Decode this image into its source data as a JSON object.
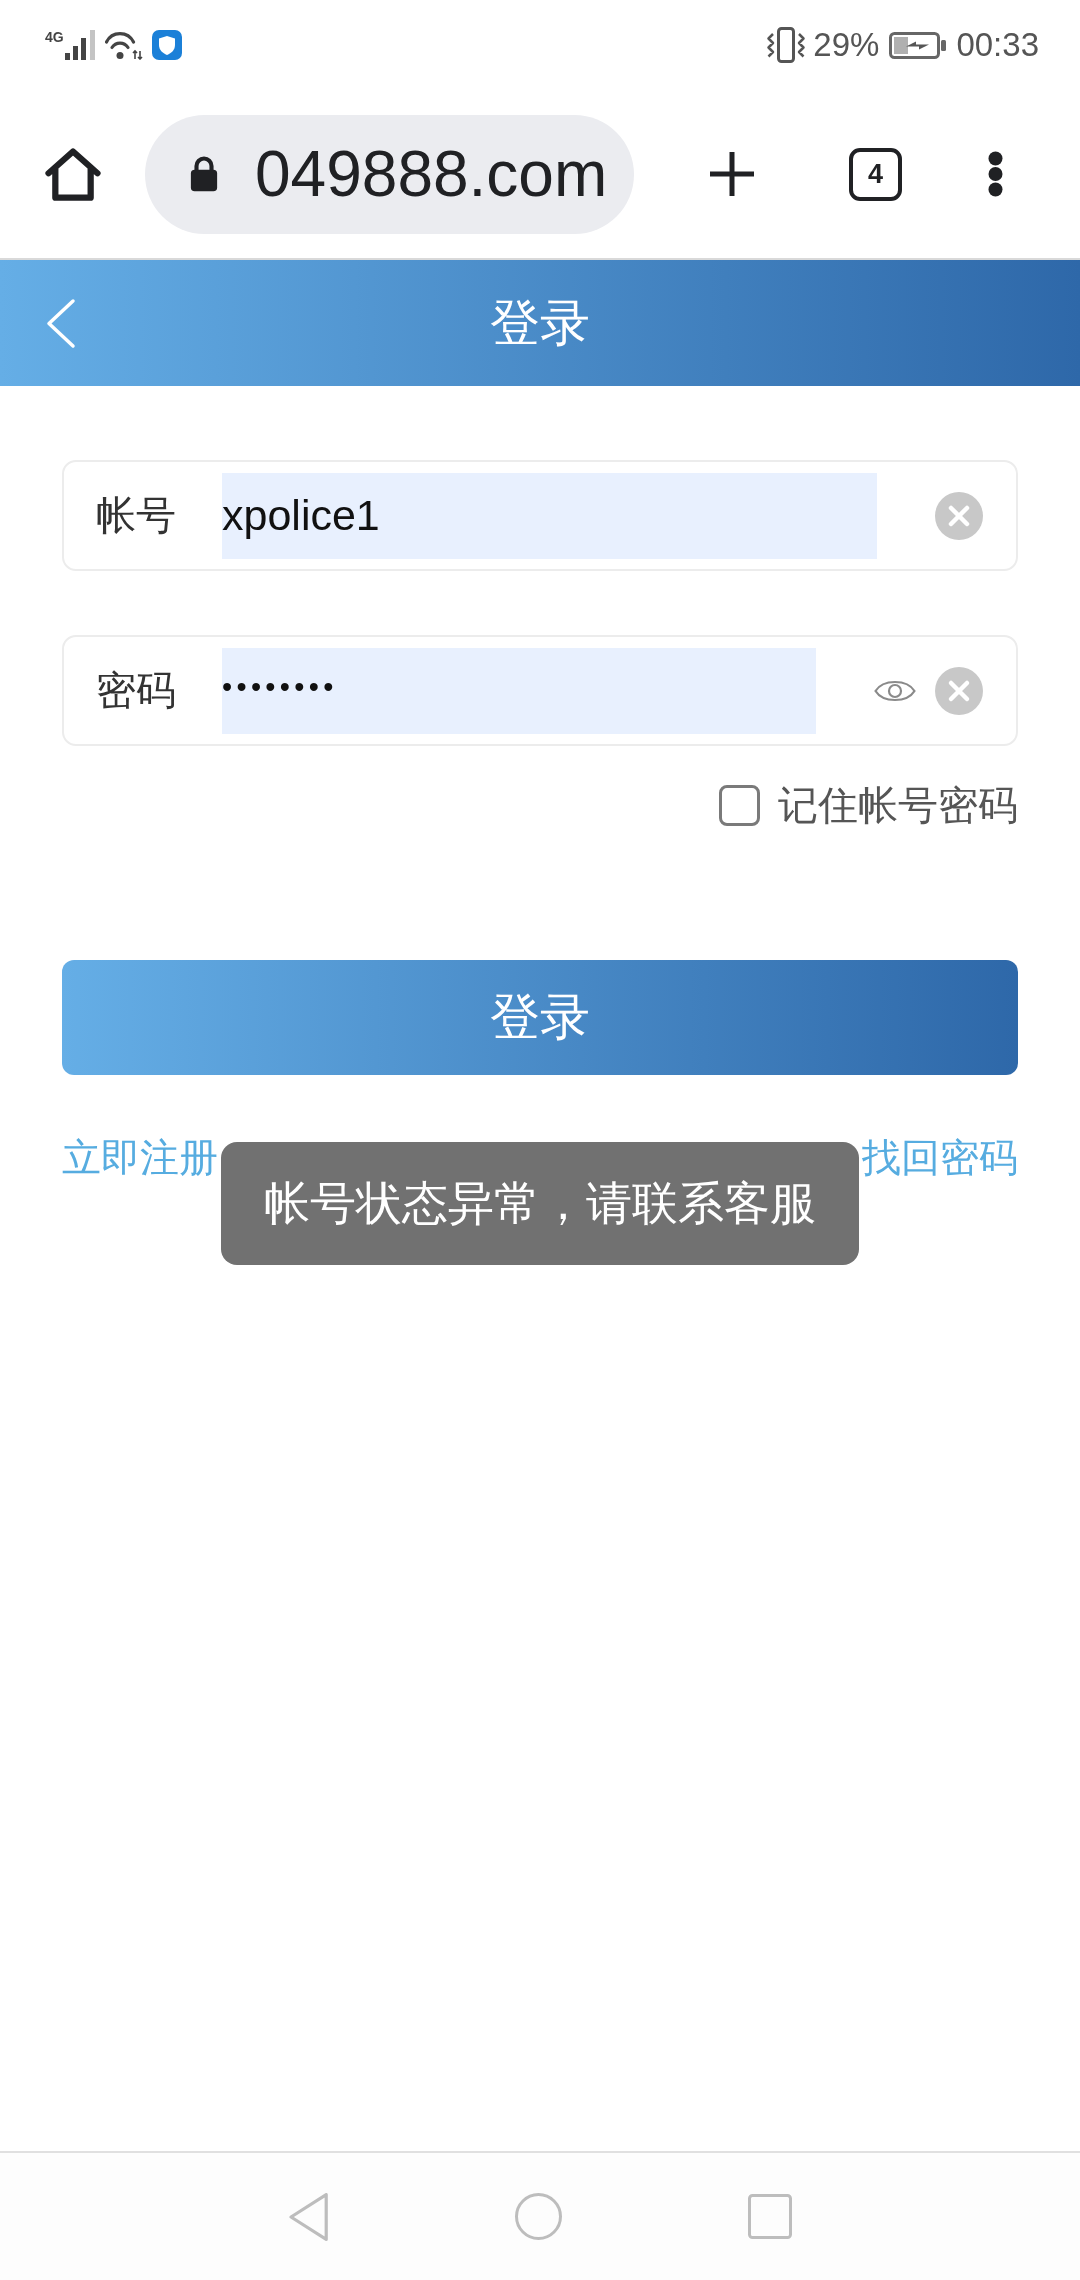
{
  "status_bar": {
    "network": "4G",
    "battery": "29%",
    "time": "00:33"
  },
  "browser_bar": {
    "address": "049888.com",
    "tab_count": "4"
  },
  "header": {
    "title": "登录"
  },
  "form": {
    "fields": [
      {
        "label": "帐号",
        "value": "xpolice1",
        "kind": "text"
      },
      {
        "label": "密码",
        "value": "••••••••",
        "kind": "password"
      }
    ],
    "remember": {
      "label": "记住帐号密码",
      "checked": false
    },
    "submit": "登录",
    "links": [
      "立即注册",
      "找回密码"
    ]
  },
  "toast": {
    "message": "帐号状态异常，请联系客服"
  }
}
